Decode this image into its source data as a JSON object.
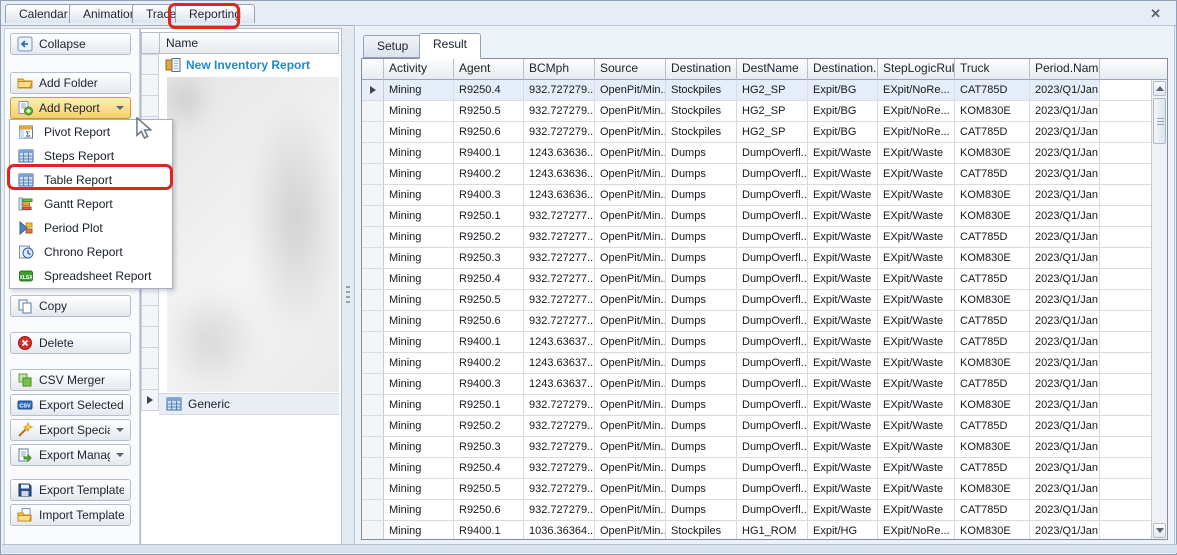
{
  "colors": {
    "annotation_red": "#e0241f",
    "link_blue": "#1d8ad2",
    "highlight_orange": "#f7cf6d"
  },
  "window": {
    "close_icon": "✕"
  },
  "tab_bar": {
    "tabs": [
      "Calendar",
      "Animation",
      "Trace",
      "Reporting"
    ],
    "active_tab": "Reporting"
  },
  "sidebar": {
    "buttons": [
      {
        "label": "Collapse",
        "icon": "collapse-icon"
      },
      {
        "label": "Add Folder",
        "icon": "add-folder-icon"
      },
      {
        "label": "Add Report",
        "icon": "add-report-icon",
        "dropdown": true,
        "highlighted": true
      },
      {
        "label": "Copy",
        "icon": "copy-icon"
      },
      {
        "label": "Delete",
        "icon": "delete-icon"
      },
      {
        "label": "CSV Merger",
        "icon": "csv-merger-icon"
      },
      {
        "label": "Export Selected",
        "icon": "export-selected-icon"
      },
      {
        "label": "Export Special",
        "icon": "export-special-icon",
        "dropdown": true
      },
      {
        "label": "Export Manager",
        "icon": "export-manager-icon",
        "dropdown": true
      },
      {
        "label": "Export Templates",
        "icon": "export-templates-icon"
      },
      {
        "label": "Import Template",
        "icon": "import-template-icon"
      }
    ]
  },
  "report_menu": {
    "items": [
      {
        "label": "Pivot Report",
        "icon": "pivot-report-icon"
      },
      {
        "label": "Steps Report",
        "icon": "steps-report-icon"
      },
      {
        "label": "Table Report",
        "icon": "table-report-icon",
        "annotated": true
      },
      {
        "label": "Gantt Report",
        "icon": "gantt-report-icon"
      },
      {
        "label": "Period Plot",
        "icon": "period-plot-icon"
      },
      {
        "label": "Chrono Report",
        "icon": "chrono-report-icon"
      },
      {
        "label": "Spreadsheet Report",
        "icon": "spreadsheet-report-icon"
      }
    ]
  },
  "tree_panel": {
    "header": "Name",
    "top_item": {
      "label": "New Inventory Report",
      "icon": "report-node-icon"
    },
    "bottom_item": {
      "label": "Generic",
      "icon": "generic-table-icon"
    }
  },
  "result_panel": {
    "tabs": [
      {
        "label": "Setup",
        "active": false
      },
      {
        "label": "Result",
        "active": true
      }
    ]
  },
  "table": {
    "columns": [
      "Activity",
      "Agent",
      "BCMph",
      "Source",
      "Destination",
      "DestName",
      "Destination...",
      "StepLogicRule",
      "Truck",
      "Period.Name"
    ],
    "rows": [
      [
        "Mining",
        "R9250.4",
        "932.727279...",
        "OpenPit/Min...",
        "Stockpiles",
        "HG2_SP",
        "Expit/BG",
        "EXpit/NoRe...",
        "CAT785D",
        "2023/Q1/Jan"
      ],
      [
        "Mining",
        "R9250.5",
        "932.727279...",
        "OpenPit/Min...",
        "Stockpiles",
        "HG2_SP",
        "Expit/BG",
        "EXpit/NoRe...",
        "KOM830E",
        "2023/Q1/Jan"
      ],
      [
        "Mining",
        "R9250.6",
        "932.727279...",
        "OpenPit/Min...",
        "Stockpiles",
        "HG2_SP",
        "Expit/BG",
        "EXpit/NoRe...",
        "CAT785D",
        "2023/Q1/Jan"
      ],
      [
        "Mining",
        "R9400.1",
        "1243.63636...",
        "OpenPit/Min...",
        "Dumps",
        "DumpOverfl...",
        "Expit/Waste",
        "EXpit/Waste",
        "KOM830E",
        "2023/Q1/Jan"
      ],
      [
        "Mining",
        "R9400.2",
        "1243.63636...",
        "OpenPit/Min...",
        "Dumps",
        "DumpOverfl...",
        "Expit/Waste",
        "EXpit/Waste",
        "CAT785D",
        "2023/Q1/Jan"
      ],
      [
        "Mining",
        "R9400.3",
        "1243.63636...",
        "OpenPit/Min...",
        "Dumps",
        "DumpOverfl...",
        "Expit/Waste",
        "EXpit/Waste",
        "KOM830E",
        "2023/Q1/Jan"
      ],
      [
        "Mining",
        "R9250.1",
        "932.727277...",
        "OpenPit/Min...",
        "Dumps",
        "DumpOverfl...",
        "Expit/Waste",
        "EXpit/Waste",
        "KOM830E",
        "2023/Q1/Jan"
      ],
      [
        "Mining",
        "R9250.2",
        "932.727277...",
        "OpenPit/Min...",
        "Dumps",
        "DumpOverfl...",
        "Expit/Waste",
        "EXpit/Waste",
        "CAT785D",
        "2023/Q1/Jan"
      ],
      [
        "Mining",
        "R9250.3",
        "932.727277...",
        "OpenPit/Min...",
        "Dumps",
        "DumpOverfl...",
        "Expit/Waste",
        "EXpit/Waste",
        "KOM830E",
        "2023/Q1/Jan"
      ],
      [
        "Mining",
        "R9250.4",
        "932.727277...",
        "OpenPit/Min...",
        "Dumps",
        "DumpOverfl...",
        "Expit/Waste",
        "EXpit/Waste",
        "CAT785D",
        "2023/Q1/Jan"
      ],
      [
        "Mining",
        "R9250.5",
        "932.727277...",
        "OpenPit/Min...",
        "Dumps",
        "DumpOverfl...",
        "Expit/Waste",
        "EXpit/Waste",
        "KOM830E",
        "2023/Q1/Jan"
      ],
      [
        "Mining",
        "R9250.6",
        "932.727277...",
        "OpenPit/Min...",
        "Dumps",
        "DumpOverfl...",
        "Expit/Waste",
        "EXpit/Waste",
        "CAT785D",
        "2023/Q1/Jan"
      ],
      [
        "Mining",
        "R9400.1",
        "1243.63637...",
        "OpenPit/Min...",
        "Dumps",
        "DumpOverfl...",
        "Expit/Waste",
        "EXpit/Waste",
        "CAT785D",
        "2023/Q1/Jan"
      ],
      [
        "Mining",
        "R9400.2",
        "1243.63637...",
        "OpenPit/Min...",
        "Dumps",
        "DumpOverfl...",
        "Expit/Waste",
        "EXpit/Waste",
        "KOM830E",
        "2023/Q1/Jan"
      ],
      [
        "Mining",
        "R9400.3",
        "1243.63637...",
        "OpenPit/Min...",
        "Dumps",
        "DumpOverfl...",
        "Expit/Waste",
        "EXpit/Waste",
        "CAT785D",
        "2023/Q1/Jan"
      ],
      [
        "Mining",
        "R9250.1",
        "932.727279...",
        "OpenPit/Min...",
        "Dumps",
        "DumpOverfl...",
        "Expit/Waste",
        "EXpit/Waste",
        "KOM830E",
        "2023/Q1/Jan"
      ],
      [
        "Mining",
        "R9250.2",
        "932.727279...",
        "OpenPit/Min...",
        "Dumps",
        "DumpOverfl...",
        "Expit/Waste",
        "EXpit/Waste",
        "CAT785D",
        "2023/Q1/Jan"
      ],
      [
        "Mining",
        "R9250.3",
        "932.727279...",
        "OpenPit/Min...",
        "Dumps",
        "DumpOverfl...",
        "Expit/Waste",
        "EXpit/Waste",
        "KOM830E",
        "2023/Q1/Jan"
      ],
      [
        "Mining",
        "R9250.4",
        "932.727279...",
        "OpenPit/Min...",
        "Dumps",
        "DumpOverfl...",
        "Expit/Waste",
        "EXpit/Waste",
        "CAT785D",
        "2023/Q1/Jan"
      ],
      [
        "Mining",
        "R9250.5",
        "932.727279...",
        "OpenPit/Min...",
        "Dumps",
        "DumpOverfl...",
        "Expit/Waste",
        "EXpit/Waste",
        "KOM830E",
        "2023/Q1/Jan"
      ],
      [
        "Mining",
        "R9250.6",
        "932.727279...",
        "OpenPit/Min...",
        "Dumps",
        "DumpOverfl...",
        "Expit/Waste",
        "EXpit/Waste",
        "CAT785D",
        "2023/Q1/Jan"
      ],
      [
        "Mining",
        "R9400.1",
        "1036.36364...",
        "OpenPit/Min...",
        "Stockpiles",
        "HG1_ROM",
        "Expit/HG",
        "EXpit/NoRe...",
        "KOM830E",
        "2023/Q1/Jan"
      ]
    ]
  }
}
